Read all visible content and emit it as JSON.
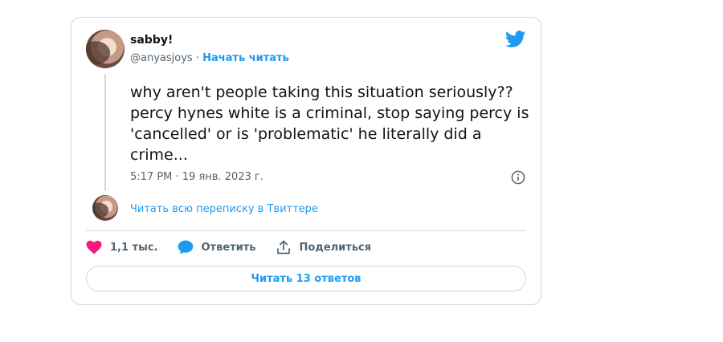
{
  "tweet": {
    "author_name": "sabby!",
    "handle": "@anyasjoys",
    "separator": " · ",
    "follow_label": "Начать читать",
    "text": "why aren't people taking this situation seriously??\npercy hynes white is a criminal, stop saying percy is\n'cancelled' or is 'problematic' he literally did a\ncrime...",
    "timestamp": "5:17 PM · 19 янв. 2023 г.",
    "read_thread_label": "Читать всю переписку в Твиттере",
    "likes_count": "1,1 тыс.",
    "reply_label": "Ответить",
    "share_label": "Поделиться",
    "read_replies_label": "Читать 13 ответов"
  },
  "icons": {
    "brand": "twitter-bird-icon",
    "info": "info-icon",
    "like": "heart-icon",
    "reply": "speech-bubble-icon",
    "share": "share-arrow-icon"
  },
  "colors": {
    "accent": "#1d9bf0",
    "like": "#f91880",
    "text": "#0f1419",
    "muted": "#536471",
    "border": "#cfd9de"
  }
}
